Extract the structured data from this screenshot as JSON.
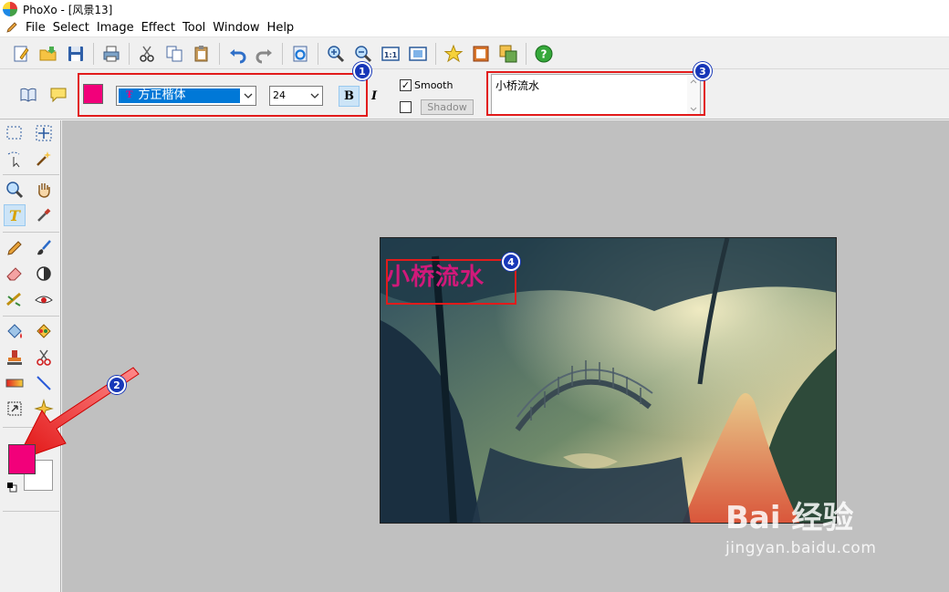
{
  "window": {
    "title": "PhoXo - [风景13]"
  },
  "menu": [
    "File",
    "Select",
    "Image",
    "Effect",
    "Tool",
    "Window",
    "Help"
  ],
  "toolbar_icons": [
    "new-document-icon",
    "open-folder-icon",
    "save-disk-icon",
    "print-icon",
    "cut-scissors-icon",
    "copy-icon",
    "paste-icon",
    "undo-icon",
    "redo-icon",
    "refresh-icon",
    "zoom-in-icon",
    "zoom-out-icon",
    "actual-size-icon",
    "fit-window-icon",
    "favorite-star-icon",
    "frame-icon",
    "layers-icon",
    "help-icon"
  ],
  "text_options": {
    "font_name": "方正楷体",
    "font_size": "24",
    "bold_label": "B",
    "italic_label": "I",
    "smooth_label": "Smooth",
    "smooth_checked": true,
    "shadow_label": "Shadow",
    "shadow_checked": false,
    "text_value": "小桥流水",
    "text_color": "#f2007a"
  },
  "badges": [
    "1",
    "2",
    "3",
    "4"
  ],
  "canvas": {
    "overlay_text": "小桥流水"
  },
  "colors": {
    "foreground": "#f2007a",
    "background": "#ffffff",
    "highlight": "#e21b1b",
    "badge": "#1737b8"
  },
  "watermark": {
    "main": "Bai 经验",
    "sub": "jingyan.baidu.com"
  }
}
